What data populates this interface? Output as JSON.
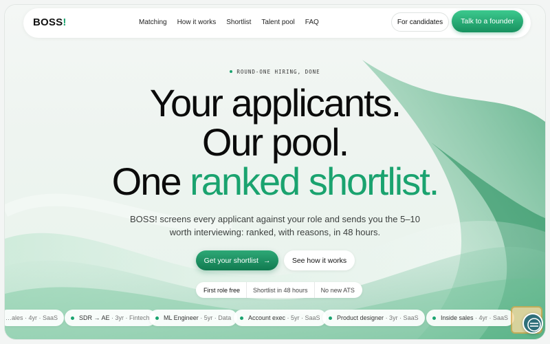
{
  "brand": {
    "name": "BOSS",
    "mark": "!",
    "accent_color": "#1aa36f"
  },
  "nav": {
    "links": [
      "Matching",
      "How it works",
      "Shortlist",
      "Talent pool",
      "FAQ"
    ],
    "candidates_label": "For candidates",
    "founder_label": "Talk to a founder"
  },
  "hero": {
    "eyebrow": "ROUND-ONE HIRING, DONE",
    "line1": "Your applicants.",
    "line2": "Our pool.",
    "line3_start": "One ",
    "line3_accent": "ranked shortlist.",
    "sub": "BOSS! screens every applicant against your role and sends you the 5–10 worth interviewing: ranked, with reasons, in 48 hours.",
    "primary_cta": "Get your shortlist",
    "primary_arrow": "→",
    "secondary_cta": "See how it works",
    "pills": [
      "First role free",
      "Shortlist in 48 hours",
      "No new ATS"
    ]
  },
  "ticker": [
    {
      "role": "…ales",
      "meta": "· 4yr · SaaS"
    },
    {
      "role": "SDR → AE",
      "meta": "· 3yr · Fintech"
    },
    {
      "role": "ML Engineer",
      "meta": "· 5yr · Data"
    },
    {
      "role": "Account exec",
      "meta": "· 5yr · SaaS"
    },
    {
      "role": "Product designer",
      "meta": "· 3yr · SaaS"
    },
    {
      "role": "Inside sales",
      "meta": "· 4yr · SaaS"
    }
  ],
  "icons": {
    "chat_widget": "chat-widget-icon",
    "arrow": "arrow-right-icon"
  }
}
